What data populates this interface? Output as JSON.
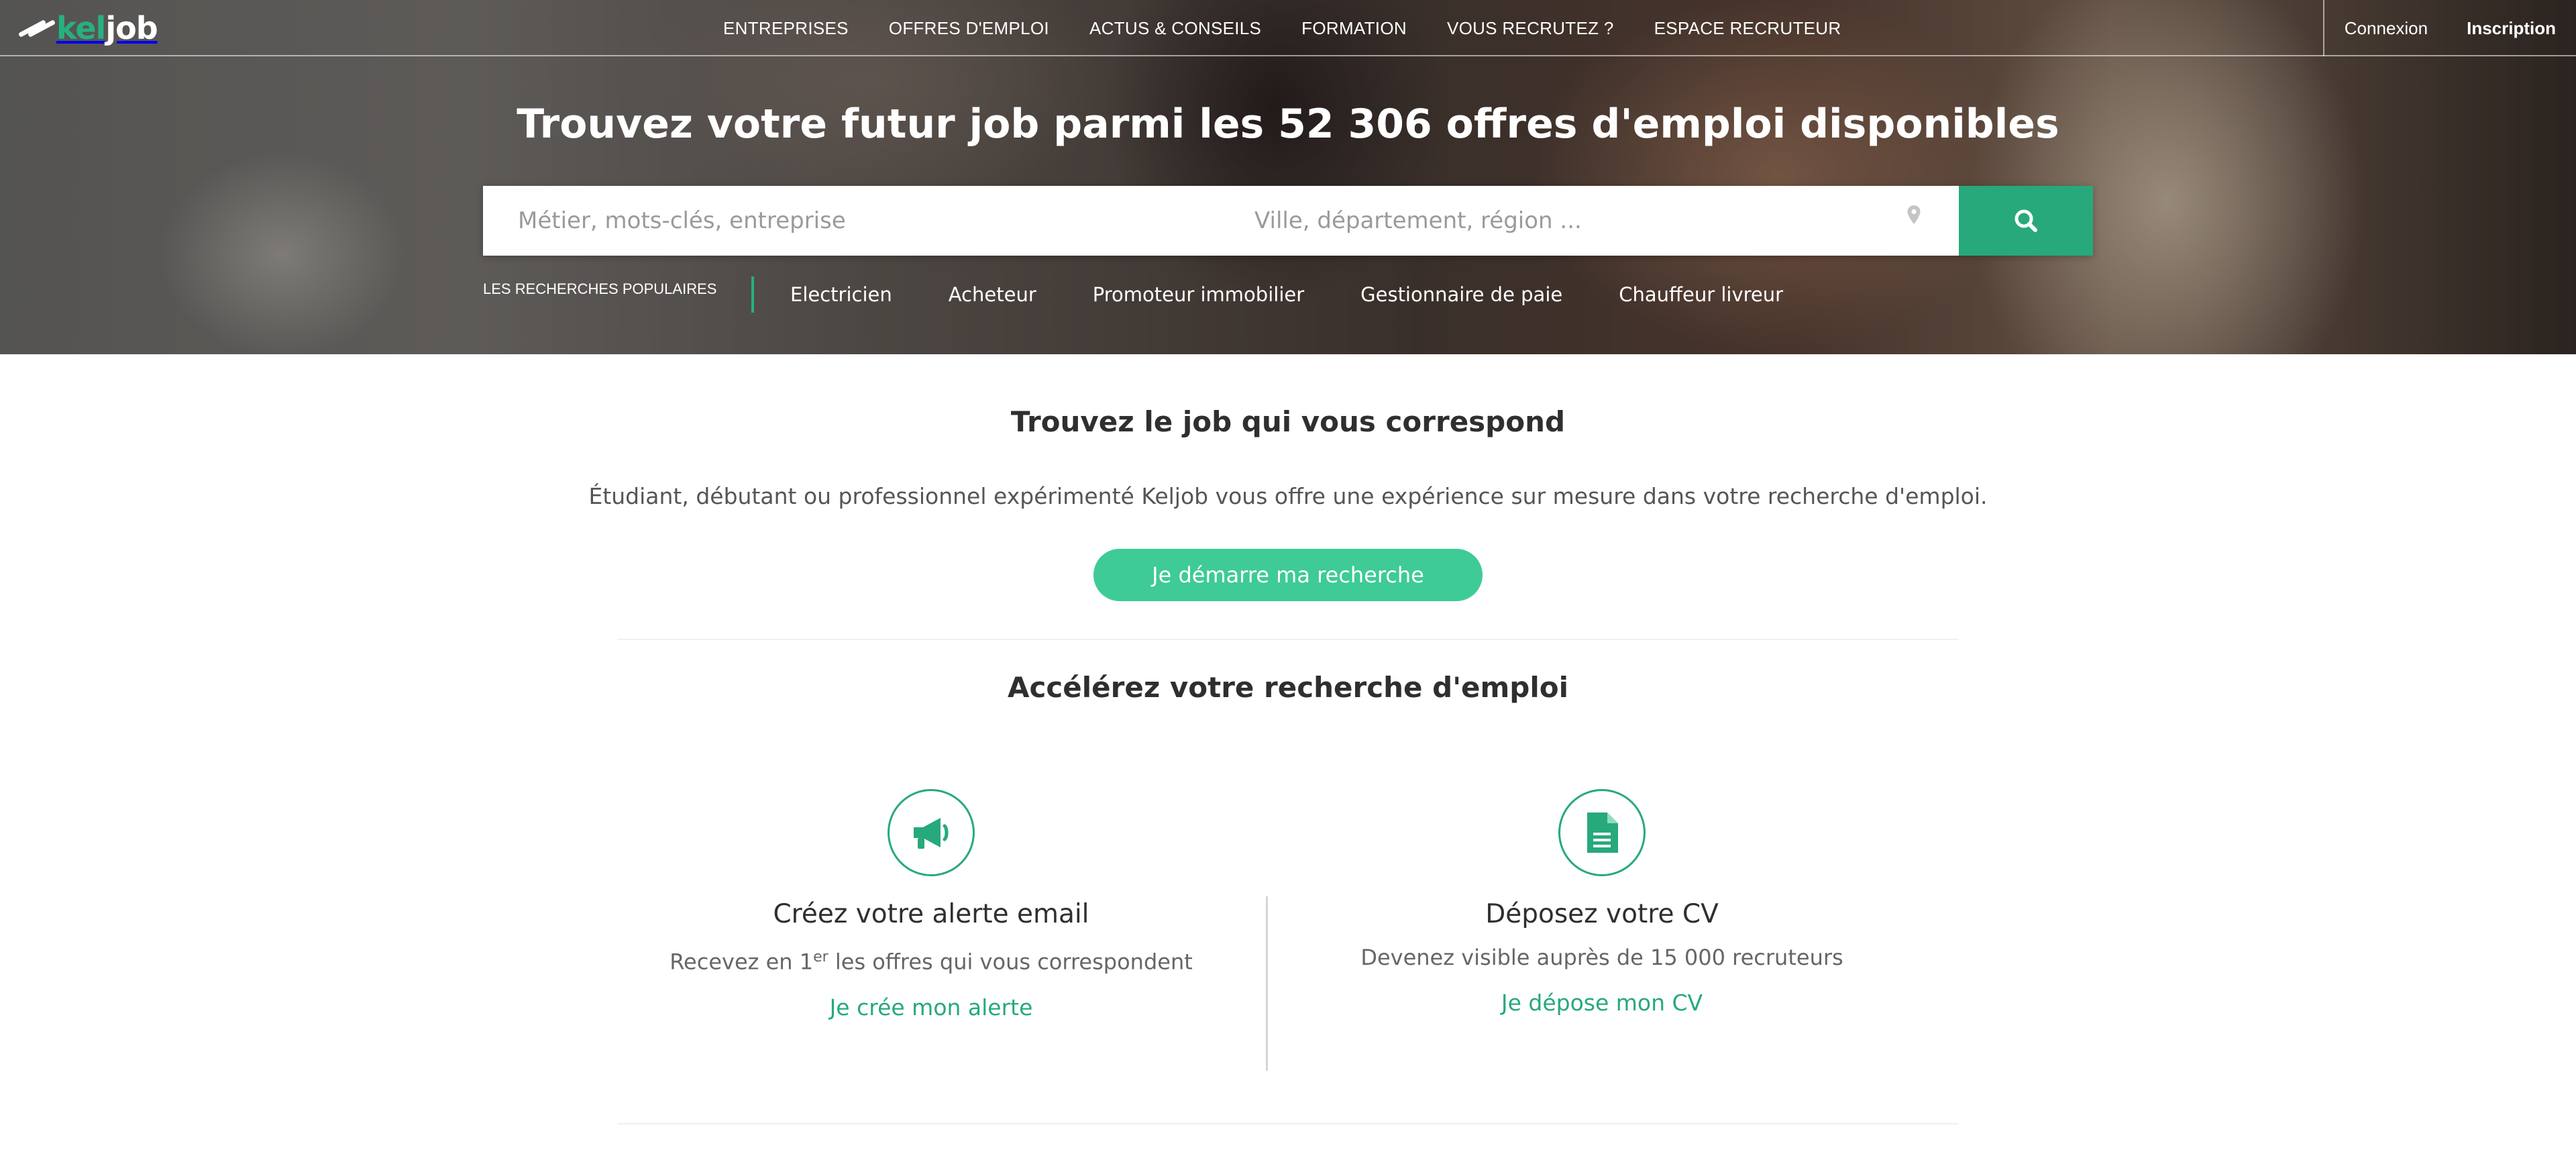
{
  "brand": {
    "logo_kel": "kel",
    "logo_job": "job",
    "accent": "#27a97b"
  },
  "nav": {
    "items": [
      "ENTREPRISES",
      "OFFRES D'EMPLOI",
      "ACTUS & CONSEILS",
      "FORMATION",
      "VOUS RECRUTEZ ?",
      "ESPACE RECRUTEUR"
    ],
    "login": "Connexion",
    "signup": "Inscription"
  },
  "hero": {
    "headline_prefix": "Trouvez votre futur job parmi les",
    "headline_count": "52 306 offres d'emploi",
    "headline_suffix": "disponibles",
    "keyword_placeholder": "Métier, mots-clés, entreprise",
    "location_placeholder": "Ville, département, région ...",
    "search_icon": "search-icon",
    "location_icon": "map-pin-icon",
    "popular_label": "LES RECHERCHES POPULAIRES",
    "popular": [
      "Electricien",
      "Acheteur",
      "Promoteur immobilier",
      "Gestionnaire de paie",
      "Chauffeur livreur"
    ]
  },
  "intro": {
    "title": "Trouvez le job qui vous correspond",
    "text": "Étudiant, débutant ou professionnel expérimenté Keljob vous offre une expérience sur mesure dans votre recherche d'emploi.",
    "cta": "Je démarre ma recherche"
  },
  "accelerate": {
    "title": "Accélérez votre recherche d'emploi",
    "alert": {
      "icon": "megaphone-icon",
      "title": "Créez votre alerte email",
      "desc_before": "Recevez en 1",
      "desc_sup": "er",
      "desc_after": " les offres qui vous correspondent",
      "link": "Je crée mon alerte"
    },
    "cv": {
      "icon": "document-icon",
      "title": "Déposez votre CV",
      "desc": "Devenez visible auprès de 15 000 recruteurs",
      "link": "Je dépose mon CV"
    }
  }
}
